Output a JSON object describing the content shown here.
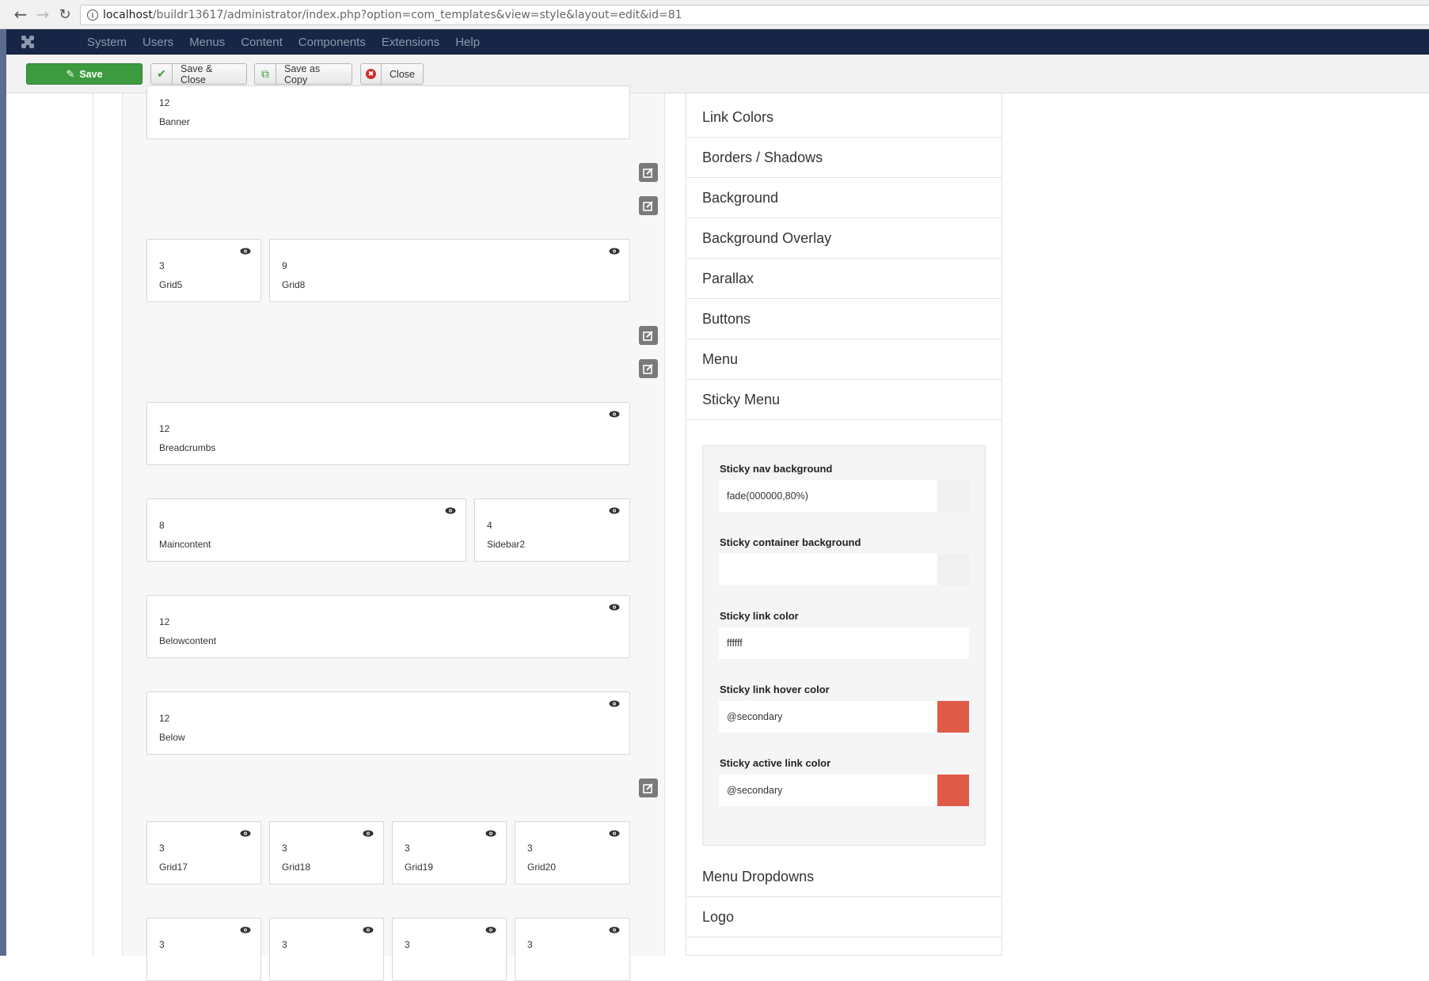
{
  "browser": {
    "url_host": "localhost",
    "url_path": "/buildr13617/administrator/index.php?option=com_templates&view=style&layout=edit&id=81"
  },
  "topnav": {
    "items": [
      "System",
      "Users",
      "Menus",
      "Content",
      "Components",
      "Extensions",
      "Help"
    ]
  },
  "toolbar": {
    "save": "Save",
    "save_close": "Save & Close",
    "save_copy": "Save as Copy",
    "close": "Close"
  },
  "layout": {
    "banner": {
      "cols": "12",
      "name": "Banner"
    },
    "grid5": {
      "cols": "3",
      "name": "Grid5"
    },
    "grid8": {
      "cols": "9",
      "name": "Grid8"
    },
    "breadcrumbs": {
      "cols": "12",
      "name": "Breadcrumbs"
    },
    "maincontent": {
      "cols": "8",
      "name": "Maincontent"
    },
    "sidebar2": {
      "cols": "4",
      "name": "Sidebar2"
    },
    "belowcontent": {
      "cols": "12",
      "name": "Belowcontent"
    },
    "below": {
      "cols": "12",
      "name": "Below"
    },
    "grid17": {
      "cols": "3",
      "name": "Grid17"
    },
    "grid18": {
      "cols": "3",
      "name": "Grid18"
    },
    "grid19": {
      "cols": "3",
      "name": "Grid19"
    },
    "grid20": {
      "cols": "3",
      "name": "Grid20"
    },
    "bottom_row": [
      {
        "cols": "3"
      },
      {
        "cols": "3"
      },
      {
        "cols": "3"
      },
      {
        "cols": "3"
      }
    ]
  },
  "settings": {
    "sections": [
      "Link Colors",
      "Borders / Shadows",
      "Background",
      "Background Overlay",
      "Parallax",
      "Buttons",
      "Menu",
      "Sticky Menu"
    ],
    "after_sections": [
      "Menu Dropdowns",
      "Logo"
    ],
    "sticky": {
      "nav_bg_label": "Sticky nav background",
      "nav_bg_value": "fade(000000,80%)",
      "container_bg_label": "Sticky container background",
      "container_bg_value": "",
      "link_color_label": "Sticky link color",
      "link_color_value": "ffffff",
      "link_hover_label": "Sticky link hover color",
      "link_hover_value": "@secondary",
      "active_link_label": "Sticky active link color",
      "active_link_value": "@secondary",
      "secondary_color": "#e05a48"
    }
  }
}
